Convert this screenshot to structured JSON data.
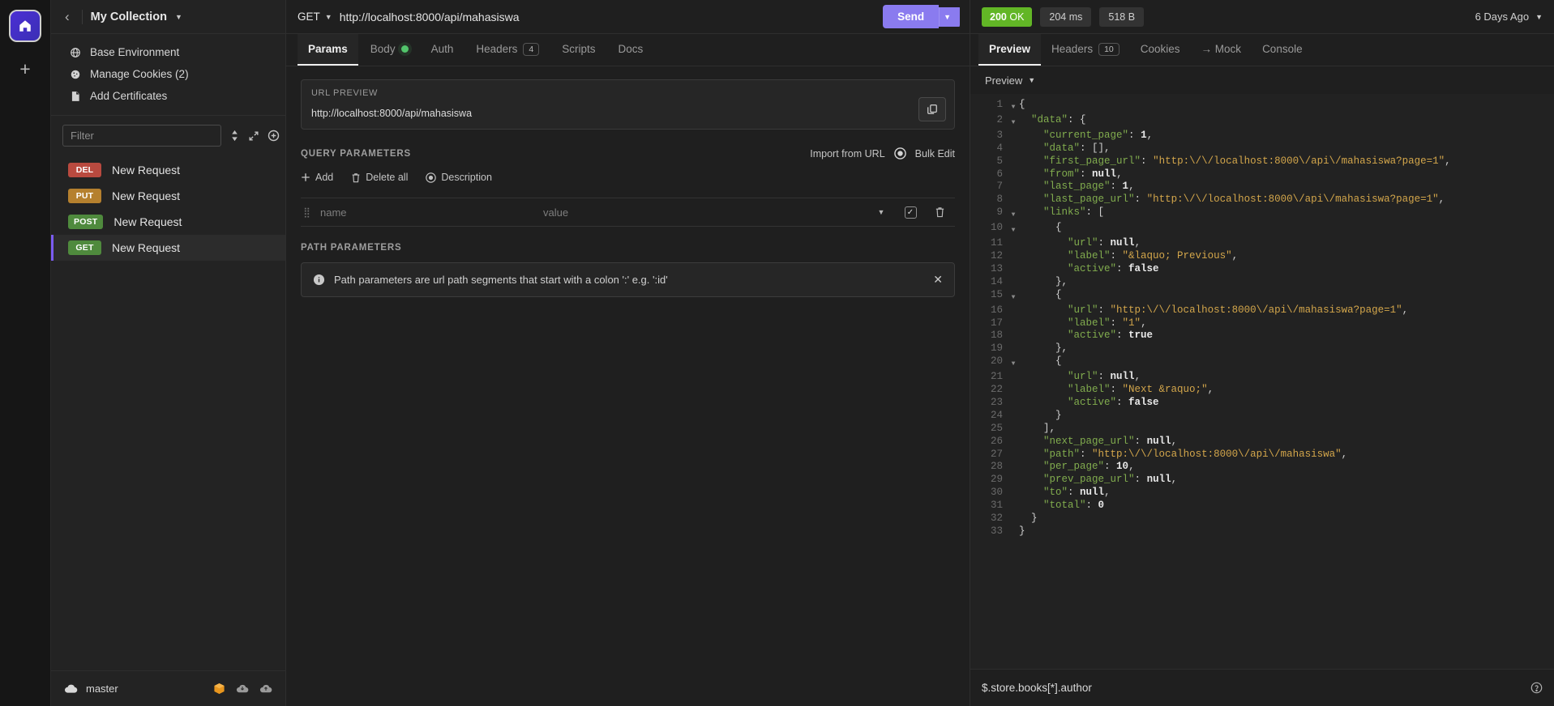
{
  "rail": {
    "home_icon": "home-icon",
    "add_icon": "plus-icon"
  },
  "sidebar": {
    "back_icon": "chevron-left-icon",
    "collection_title": "My Collection",
    "collection_caret": "chevron-down-icon",
    "links": [
      {
        "label": "Base Environment",
        "icon": "globe-icon"
      },
      {
        "label": "Manage Cookies (2)",
        "icon": "cookie-icon"
      },
      {
        "label": "Add Certificates",
        "icon": "certificate-icon"
      }
    ],
    "filter_placeholder": "Filter",
    "filter_value": "",
    "sort_icon": "sort-icon",
    "expand_icon": "expand-icon",
    "new_icon": "new-request-icon",
    "requests": [
      {
        "method": "DEL",
        "name": "New Request",
        "color": "#b94a3f",
        "active": false
      },
      {
        "method": "PUT",
        "name": "New Request",
        "color": "#b5802e",
        "active": false
      },
      {
        "method": "POST",
        "name": "New Request",
        "color": "#4f8a3d",
        "active": false
      },
      {
        "method": "GET",
        "name": "New Request",
        "color": "#4f8a3d",
        "active": true
      }
    ],
    "footer": {
      "cloud_icon": "cloud-icon",
      "branch": "master",
      "icons": [
        "package-icon",
        "cloud-download-icon",
        "cloud-upload-icon"
      ]
    }
  },
  "request": {
    "method": "GET",
    "method_caret": "chevron-down-icon",
    "url": "http://localhost:8000/api/mahasiswa",
    "send_label": "Send",
    "send_caret": "chevron-down-icon",
    "tabs": [
      {
        "label": "Params",
        "active": true,
        "badge": null,
        "dot": false
      },
      {
        "label": "Body",
        "active": false,
        "badge": null,
        "dot": true
      },
      {
        "label": "Auth",
        "active": false,
        "badge": null,
        "dot": false
      },
      {
        "label": "Headers",
        "active": false,
        "badge": "4",
        "dot": false
      },
      {
        "label": "Scripts",
        "active": false,
        "badge": null,
        "dot": false
      },
      {
        "label": "Docs",
        "active": false,
        "badge": null,
        "dot": false
      }
    ],
    "url_preview": {
      "label": "URL PREVIEW",
      "value": "http://localhost:8000/api/mahasiswa",
      "copy_icon": "copy-icon"
    },
    "query_parameters": {
      "title": "QUERY PARAMETERS",
      "import_from_url": "Import from URL",
      "toggle_icon": "toggle-icon",
      "bulk_edit": "Bulk Edit",
      "actions": [
        {
          "label": "Add",
          "icon": "plus-icon"
        },
        {
          "label": "Delete all",
          "icon": "trash-icon"
        },
        {
          "label": "Description",
          "icon": "description-icon"
        }
      ],
      "row": {
        "grip_icon": "drag-handle-icon",
        "name_placeholder": "name",
        "value_placeholder": "value",
        "caret_icon": "chevron-down-icon",
        "checkbox_icon": "checkbox-checked-icon",
        "delete_icon": "trash-icon"
      }
    },
    "path_parameters": {
      "title": "PATH PARAMETERS",
      "info_icon": "info-icon",
      "note": "Path parameters are url path segments that start with a colon ':' e.g. ':id'",
      "close_icon": "close-icon"
    }
  },
  "response": {
    "status_code": "200",
    "status_text": "OK",
    "time": "204 ms",
    "size": "518 B",
    "history_label": "6 Days Ago",
    "history_caret": "chevron-down-icon",
    "tabs": [
      {
        "label": "Preview",
        "active": true,
        "badge": null
      },
      {
        "label": "Headers",
        "active": false,
        "badge": "10"
      },
      {
        "label": "Cookies",
        "active": false,
        "badge": null
      },
      {
        "label": "→ Mock",
        "active": false,
        "badge": null
      },
      {
        "label": "Console",
        "active": false,
        "badge": null
      }
    ],
    "view_mode": "Preview",
    "view_caret": "chevron-down-icon",
    "filter_expression": "$.store.books[*].author",
    "help_icon": "help-icon",
    "body_lines": [
      {
        "n": 1,
        "fold": true,
        "tokens": [
          [
            "p",
            "{"
          ]
        ]
      },
      {
        "n": 2,
        "fold": true,
        "tokens": [
          [
            "p",
            "  "
          ],
          [
            "k",
            "\"data\""
          ],
          [
            "p",
            ": {"
          ]
        ]
      },
      {
        "n": 3,
        "fold": false,
        "tokens": [
          [
            "p",
            "    "
          ],
          [
            "k",
            "\"current_page\""
          ],
          [
            "p",
            ": "
          ],
          [
            "n",
            "1"
          ],
          [
            "p",
            ","
          ]
        ]
      },
      {
        "n": 4,
        "fold": false,
        "tokens": [
          [
            "p",
            "    "
          ],
          [
            "k",
            "\"data\""
          ],
          [
            "p",
            ": [],"
          ]
        ]
      },
      {
        "n": 5,
        "fold": false,
        "tokens": [
          [
            "p",
            "    "
          ],
          [
            "k",
            "\"first_page_url\""
          ],
          [
            "p",
            ": "
          ],
          [
            "s",
            "\"http:\\/\\/localhost:8000\\/api\\/mahasiswa?page=1\""
          ],
          [
            "p",
            ","
          ]
        ]
      },
      {
        "n": 6,
        "fold": false,
        "tokens": [
          [
            "p",
            "    "
          ],
          [
            "k",
            "\"from\""
          ],
          [
            "p",
            ": "
          ],
          [
            "n",
            "null"
          ],
          [
            "p",
            ","
          ]
        ]
      },
      {
        "n": 7,
        "fold": false,
        "tokens": [
          [
            "p",
            "    "
          ],
          [
            "k",
            "\"last_page\""
          ],
          [
            "p",
            ": "
          ],
          [
            "n",
            "1"
          ],
          [
            "p",
            ","
          ]
        ]
      },
      {
        "n": 8,
        "fold": false,
        "tokens": [
          [
            "p",
            "    "
          ],
          [
            "k",
            "\"last_page_url\""
          ],
          [
            "p",
            ": "
          ],
          [
            "s",
            "\"http:\\/\\/localhost:8000\\/api\\/mahasiswa?page=1\""
          ],
          [
            "p",
            ","
          ]
        ]
      },
      {
        "n": 9,
        "fold": true,
        "tokens": [
          [
            "p",
            "    "
          ],
          [
            "k",
            "\"links\""
          ],
          [
            "p",
            ": ["
          ]
        ]
      },
      {
        "n": 10,
        "fold": true,
        "tokens": [
          [
            "p",
            "      {"
          ]
        ]
      },
      {
        "n": 11,
        "fold": false,
        "tokens": [
          [
            "p",
            "        "
          ],
          [
            "k",
            "\"url\""
          ],
          [
            "p",
            ": "
          ],
          [
            "n",
            "null"
          ],
          [
            "p",
            ","
          ]
        ]
      },
      {
        "n": 12,
        "fold": false,
        "tokens": [
          [
            "p",
            "        "
          ],
          [
            "k",
            "\"label\""
          ],
          [
            "p",
            ": "
          ],
          [
            "s",
            "\"&laquo; Previous\""
          ],
          [
            "p",
            ","
          ]
        ]
      },
      {
        "n": 13,
        "fold": false,
        "tokens": [
          [
            "p",
            "        "
          ],
          [
            "k",
            "\"active\""
          ],
          [
            "p",
            ": "
          ],
          [
            "n",
            "false"
          ]
        ]
      },
      {
        "n": 14,
        "fold": false,
        "tokens": [
          [
            "p",
            "      },"
          ]
        ]
      },
      {
        "n": 15,
        "fold": true,
        "tokens": [
          [
            "p",
            "      {"
          ]
        ]
      },
      {
        "n": 16,
        "fold": false,
        "tokens": [
          [
            "p",
            "        "
          ],
          [
            "k",
            "\"url\""
          ],
          [
            "p",
            ": "
          ],
          [
            "s",
            "\"http:\\/\\/localhost:8000\\/api\\/mahasiswa?page=1\""
          ],
          [
            "p",
            ","
          ]
        ]
      },
      {
        "n": 17,
        "fold": false,
        "tokens": [
          [
            "p",
            "        "
          ],
          [
            "k",
            "\"label\""
          ],
          [
            "p",
            ": "
          ],
          [
            "s",
            "\"1\""
          ],
          [
            "p",
            ","
          ]
        ]
      },
      {
        "n": 18,
        "fold": false,
        "tokens": [
          [
            "p",
            "        "
          ],
          [
            "k",
            "\"active\""
          ],
          [
            "p",
            ": "
          ],
          [
            "n",
            "true"
          ]
        ]
      },
      {
        "n": 19,
        "fold": false,
        "tokens": [
          [
            "p",
            "      },"
          ]
        ]
      },
      {
        "n": 20,
        "fold": true,
        "tokens": [
          [
            "p",
            "      {"
          ]
        ]
      },
      {
        "n": 21,
        "fold": false,
        "tokens": [
          [
            "p",
            "        "
          ],
          [
            "k",
            "\"url\""
          ],
          [
            "p",
            ": "
          ],
          [
            "n",
            "null"
          ],
          [
            "p",
            ","
          ]
        ]
      },
      {
        "n": 22,
        "fold": false,
        "tokens": [
          [
            "p",
            "        "
          ],
          [
            "k",
            "\"label\""
          ],
          [
            "p",
            ": "
          ],
          [
            "s",
            "\"Next &raquo;\""
          ],
          [
            "p",
            ","
          ]
        ]
      },
      {
        "n": 23,
        "fold": false,
        "tokens": [
          [
            "p",
            "        "
          ],
          [
            "k",
            "\"active\""
          ],
          [
            "p",
            ": "
          ],
          [
            "n",
            "false"
          ]
        ]
      },
      {
        "n": 24,
        "fold": false,
        "tokens": [
          [
            "p",
            "      }"
          ]
        ]
      },
      {
        "n": 25,
        "fold": false,
        "tokens": [
          [
            "p",
            "    ],"
          ]
        ]
      },
      {
        "n": 26,
        "fold": false,
        "tokens": [
          [
            "p",
            "    "
          ],
          [
            "k",
            "\"next_page_url\""
          ],
          [
            "p",
            ": "
          ],
          [
            "n",
            "null"
          ],
          [
            "p",
            ","
          ]
        ]
      },
      {
        "n": 27,
        "fold": false,
        "tokens": [
          [
            "p",
            "    "
          ],
          [
            "k",
            "\"path\""
          ],
          [
            "p",
            ": "
          ],
          [
            "s",
            "\"http:\\/\\/localhost:8000\\/api\\/mahasiswa\""
          ],
          [
            "p",
            ","
          ]
        ]
      },
      {
        "n": 28,
        "fold": false,
        "tokens": [
          [
            "p",
            "    "
          ],
          [
            "k",
            "\"per_page\""
          ],
          [
            "p",
            ": "
          ],
          [
            "n",
            "10"
          ],
          [
            "p",
            ","
          ]
        ]
      },
      {
        "n": 29,
        "fold": false,
        "tokens": [
          [
            "p",
            "    "
          ],
          [
            "k",
            "\"prev_page_url\""
          ],
          [
            "p",
            ": "
          ],
          [
            "n",
            "null"
          ],
          [
            "p",
            ","
          ]
        ]
      },
      {
        "n": 30,
        "fold": false,
        "tokens": [
          [
            "p",
            "    "
          ],
          [
            "k",
            "\"to\""
          ],
          [
            "p",
            ": "
          ],
          [
            "n",
            "null"
          ],
          [
            "p",
            ","
          ]
        ]
      },
      {
        "n": 31,
        "fold": false,
        "tokens": [
          [
            "p",
            "    "
          ],
          [
            "k",
            "\"total\""
          ],
          [
            "p",
            ": "
          ],
          [
            "n",
            "0"
          ]
        ]
      },
      {
        "n": 32,
        "fold": false,
        "tokens": [
          [
            "p",
            "  }"
          ]
        ]
      },
      {
        "n": 33,
        "fold": false,
        "tokens": [
          [
            "p",
            "}"
          ]
        ]
      }
    ]
  },
  "colors": {
    "accent": "#8a7bef",
    "status_ok": "#62b626",
    "json_key": "#81ac4e",
    "json_string": "#d3a64b"
  }
}
